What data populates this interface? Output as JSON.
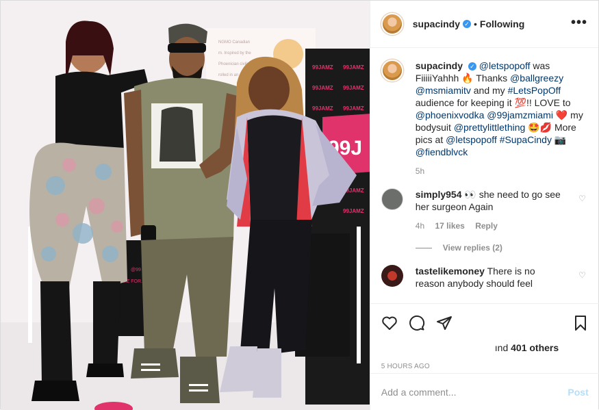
{
  "post": {
    "username": "supacindy",
    "follow_status": "Following",
    "separator": "•",
    "more_label": "•••",
    "verified_mark": "✓"
  },
  "caption": {
    "username": "supacindy",
    "parts": {
      "m1": "@letspopoff",
      "t1": " was FiiiiiYahhh 🔥 Thanks ",
      "m2": "@ballgreezy",
      "t2": " ",
      "m3": "@msmiamitv",
      "t3": " and my ",
      "h1": "#LetsPopOff",
      "t4": " audience for keeping it 💯!! LOVE to ",
      "m4": "@phoenixvodka",
      "t5": " ",
      "m5": "@99jamzmiami",
      "t6": " ❤️ my bodysuit ",
      "m6": "@prettylittlething",
      "t7": " 🤩💋 More pics at ",
      "m7": "@letspopoff",
      "t8": " ",
      "h2": "#SupaCindy",
      "t9": " 📷 ",
      "m8": "@fiendblvck"
    },
    "age": "5h"
  },
  "comments": [
    {
      "username": "simply954",
      "text": "👀 she need to go see her surgeon Again",
      "age": "4h",
      "likes": "17 likes",
      "reply_label": "Reply",
      "avatar_color": "#6b6e6a"
    },
    {
      "username": "tastelikemoney",
      "text": "There is no reason anybody should feel",
      "avatar_color": "#3a1a18"
    }
  ],
  "view_replies": "View replies (2)",
  "actions": {
    "likes_prefix": "ınd",
    "likes_count": "401 others",
    "timestamp": "5 HOURS AGO"
  },
  "add_comment": {
    "placeholder": "Add a comment...",
    "post_label": "Post"
  },
  "photo": {
    "backdrop_text": "99JAMZ",
    "poster_text": "FM AND 99JAMZ",
    "colors": {
      "wall": "#f4eff1",
      "floor": "#ece8ea",
      "backdrop": "#1a1a1a",
      "accent_pink": "#e0336b"
    }
  },
  "colors": {
    "link": "#00376b",
    "verified": "#3897f0",
    "muted": "#8e8e8e",
    "post_disabled": "#b2dffc"
  }
}
